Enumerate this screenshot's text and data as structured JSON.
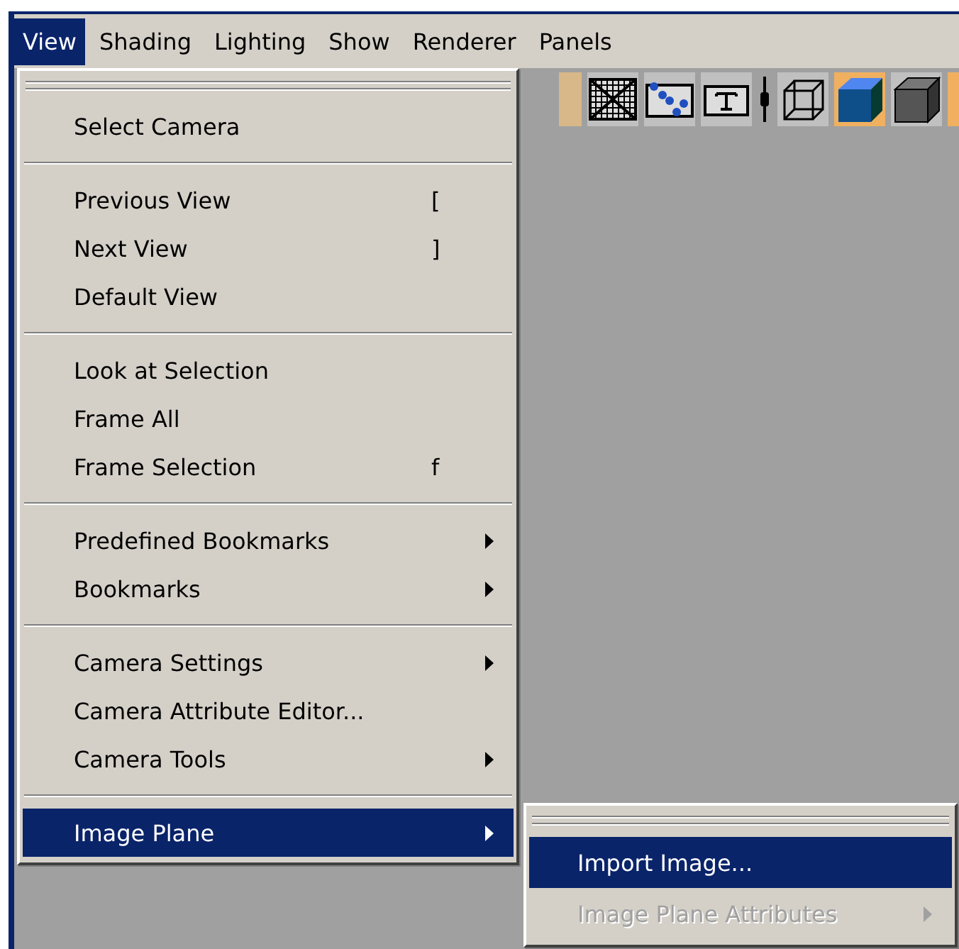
{
  "menu_bar": [
    {
      "label": "View",
      "selected": true
    },
    {
      "label": "Shading",
      "selected": false
    },
    {
      "label": "Lighting",
      "selected": false
    },
    {
      "label": "Show",
      "selected": false
    },
    {
      "label": "Renderer",
      "selected": false
    },
    {
      "label": "Panels",
      "selected": false
    }
  ],
  "toolbar": [
    {
      "kind": "partial",
      "selected": false
    },
    {
      "kind": "grid",
      "selected": false
    },
    {
      "kind": "dots",
      "selected": false
    },
    {
      "kind": "text",
      "selected": false
    },
    {
      "kind": "divider",
      "selected": false
    },
    {
      "kind": "wire-cube",
      "selected": false
    },
    {
      "kind": "shaded-cube",
      "selected": true
    },
    {
      "kind": "dark-cube",
      "selected": false
    },
    {
      "kind": "partial",
      "selected": true
    }
  ],
  "view_menu": {
    "sections": [
      [
        {
          "label": "Select Camera",
          "selected": false,
          "submenu": false
        }
      ],
      [
        {
          "label": "Previous View",
          "shortcut": "[",
          "selected": false,
          "submenu": false
        },
        {
          "label": "Next View",
          "shortcut": "]",
          "selected": false,
          "submenu": false
        },
        {
          "label": "Default View",
          "selected": false,
          "submenu": false
        }
      ],
      [
        {
          "label": "Look at Selection",
          "selected": false,
          "submenu": false
        },
        {
          "label": "Frame All",
          "selected": false,
          "submenu": false
        },
        {
          "label": "Frame Selection",
          "shortcut": "f",
          "selected": false,
          "submenu": false
        }
      ],
      [
        {
          "label": "Predefined Bookmarks",
          "selected": false,
          "submenu": true
        },
        {
          "label": "Bookmarks",
          "selected": false,
          "submenu": true
        }
      ],
      [
        {
          "label": "Camera Settings",
          "selected": false,
          "submenu": true
        },
        {
          "label": "Camera Attribute Editor...",
          "selected": false,
          "submenu": false
        },
        {
          "label": "Camera Tools",
          "selected": false,
          "submenu": true
        }
      ],
      [
        {
          "label": "Image Plane",
          "selected": true,
          "submenu": true
        }
      ]
    ]
  },
  "image_plane_submenu": {
    "items": [
      {
        "label": "Import Image...",
        "selected": true,
        "disabled": false,
        "submenu": false
      },
      {
        "label": "Image Plane Attributes",
        "selected": false,
        "disabled": true,
        "submenu": true
      }
    ]
  }
}
